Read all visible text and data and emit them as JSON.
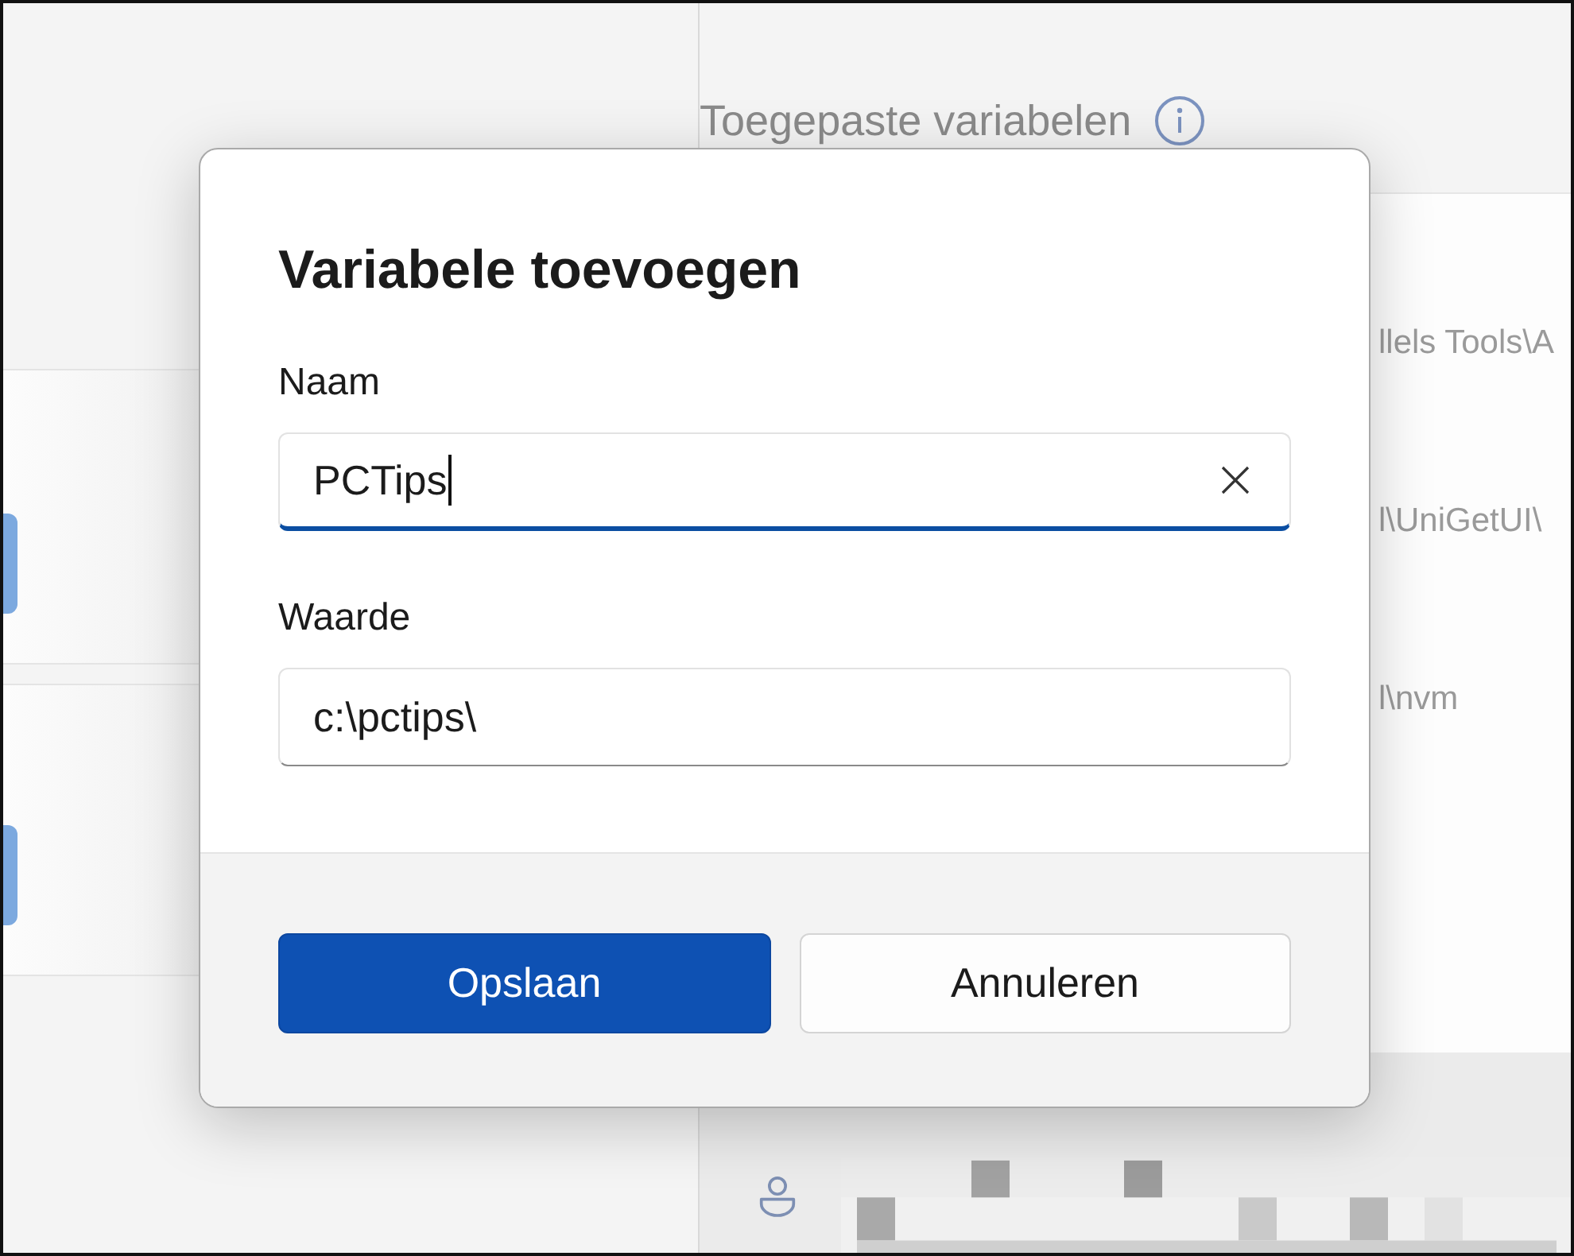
{
  "background": {
    "heading": "Toegepaste variabelen",
    "variable_rows": [
      {
        "value": "llels Tools\\A"
      },
      {
        "value": "l\\UniGetUI\\"
      },
      {
        "value": "l\\nvm"
      }
    ]
  },
  "dialog": {
    "title": "Variabele toevoegen",
    "fields": [
      {
        "label": "Naam",
        "value": "PCTips",
        "focused": true
      },
      {
        "label": "Waarde",
        "value": "c:\\pctips\\",
        "focused": false
      }
    ],
    "buttons": [
      {
        "label": "Opslaan",
        "kind": "primary"
      },
      {
        "label": "Annuleren",
        "kind": "secondary"
      }
    ]
  }
}
